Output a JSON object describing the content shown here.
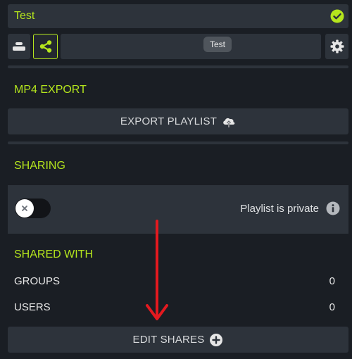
{
  "header": {
    "title": "Test",
    "status_icon": "check-circle-icon"
  },
  "toolbar": {
    "layers_icon": "layers-icon",
    "share_icon": "share-icon",
    "settings_icon": "gear-icon",
    "tooltip": "Test"
  },
  "mp4_export": {
    "heading": "MP4 EXPORT",
    "export_label": "EXPORT PLAYLIST",
    "export_icon": "cloud-upload-icon"
  },
  "sharing": {
    "heading": "SHARING",
    "toggle_on": false,
    "status_text": "Playlist is private",
    "info_icon": "info-icon"
  },
  "shared_with": {
    "heading": "SHARED WITH",
    "rows": [
      {
        "label": "GROUPS",
        "value": "0"
      },
      {
        "label": "USERS",
        "value": "0"
      }
    ],
    "edit_label": "EDIT SHARES",
    "edit_icon": "plus-circle-icon"
  },
  "colors": {
    "accent": "#b5e61d",
    "panel": "#2d333b",
    "background": "#1a1e24",
    "annotation_arrow": "#e3191f"
  }
}
